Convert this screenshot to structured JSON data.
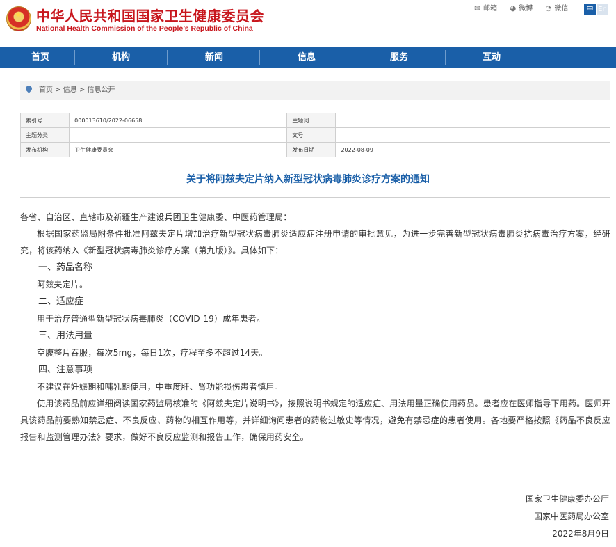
{
  "header": {
    "title_cn": "中华人民共和国国家卫生健康委员会",
    "title_en": "National Health Commission of the People’s Republic of China",
    "tools": [
      {
        "icon": "mail-icon",
        "glyph": "✉",
        "label": "邮箱"
      },
      {
        "icon": "weibo-icon",
        "glyph": "◕",
        "label": "微博"
      },
      {
        "icon": "wechat-icon",
        "glyph": "◔",
        "label": "微信"
      }
    ],
    "lang_zh": "中",
    "lang_en": "En"
  },
  "nav": [
    "首页",
    "机构",
    "新闻",
    "信息",
    "服务",
    "互动"
  ],
  "breadcrumb": {
    "items": [
      "首页",
      "信息",
      "信息公开"
    ],
    "separator": ">"
  },
  "info_table": {
    "rows": [
      {
        "k1": "索引号",
        "v1": "000013610/2022-06658",
        "k2": "主题词",
        "v2": ""
      },
      {
        "k1": "主题分类",
        "v1": "",
        "k2": "文号",
        "v2": ""
      },
      {
        "k1": "发布机构",
        "v1": "卫生健康委员会",
        "k2": "发布日期",
        "v2": "2022-08-09"
      }
    ]
  },
  "article": {
    "title": "关于将阿兹夫定片纳入新型冠状病毒肺炎诊疗方案的通知",
    "salutation": "各省、自治区、直辖市及新疆生产建设兵团卫生健康委、中医药管理局：",
    "intro": "根据国家药监局附条件批准阿兹夫定片增加治疗新型冠状病毒肺炎适应症注册申请的审批意见，为进一步完善新型冠状病毒肺炎抗病毒治疗方案，经研究，将该药纳入《新型冠状病毒肺炎诊疗方案（第九版）》。具体如下：",
    "sections": [
      {
        "heading": "一、药品名称",
        "text": "阿兹夫定片。"
      },
      {
        "heading": "二、适应症",
        "text": "用于治疗普通型新型冠状病毒肺炎（COVID-19）成年患者。"
      },
      {
        "heading": "三、用法用量",
        "text": "空腹整片吞服，每次5mg，每日1次，疗程至多不超过14天。"
      },
      {
        "heading": "四、注意事项",
        "text": "不建议在妊娠期和哺乳期使用，中重度肝、肾功能损伤患者慎用。"
      }
    ],
    "closing": "使用该药品前应详细阅读国家药监局核准的《阿兹夫定片说明书》，按照说明书规定的适应症、用法用量正确使用药品。患者应在医师指导下用药。医师开具该药品前要熟知禁忌症、不良反应、药物的相互作用等，并详细询问患者的药物过敏史等情况，避免有禁忌症的患者使用。各地要严格按照《药品不良反应报告和监测管理办法》要求，做好不良反应监测和报告工作，确保用药安全。",
    "signatures": [
      "国家卫生健康委办公厅",
      "国家中医药局办公室",
      "2022年8月9日"
    ]
  },
  "colors": {
    "brand_red": "#c8161d",
    "nav_blue": "#1a5fa8"
  }
}
